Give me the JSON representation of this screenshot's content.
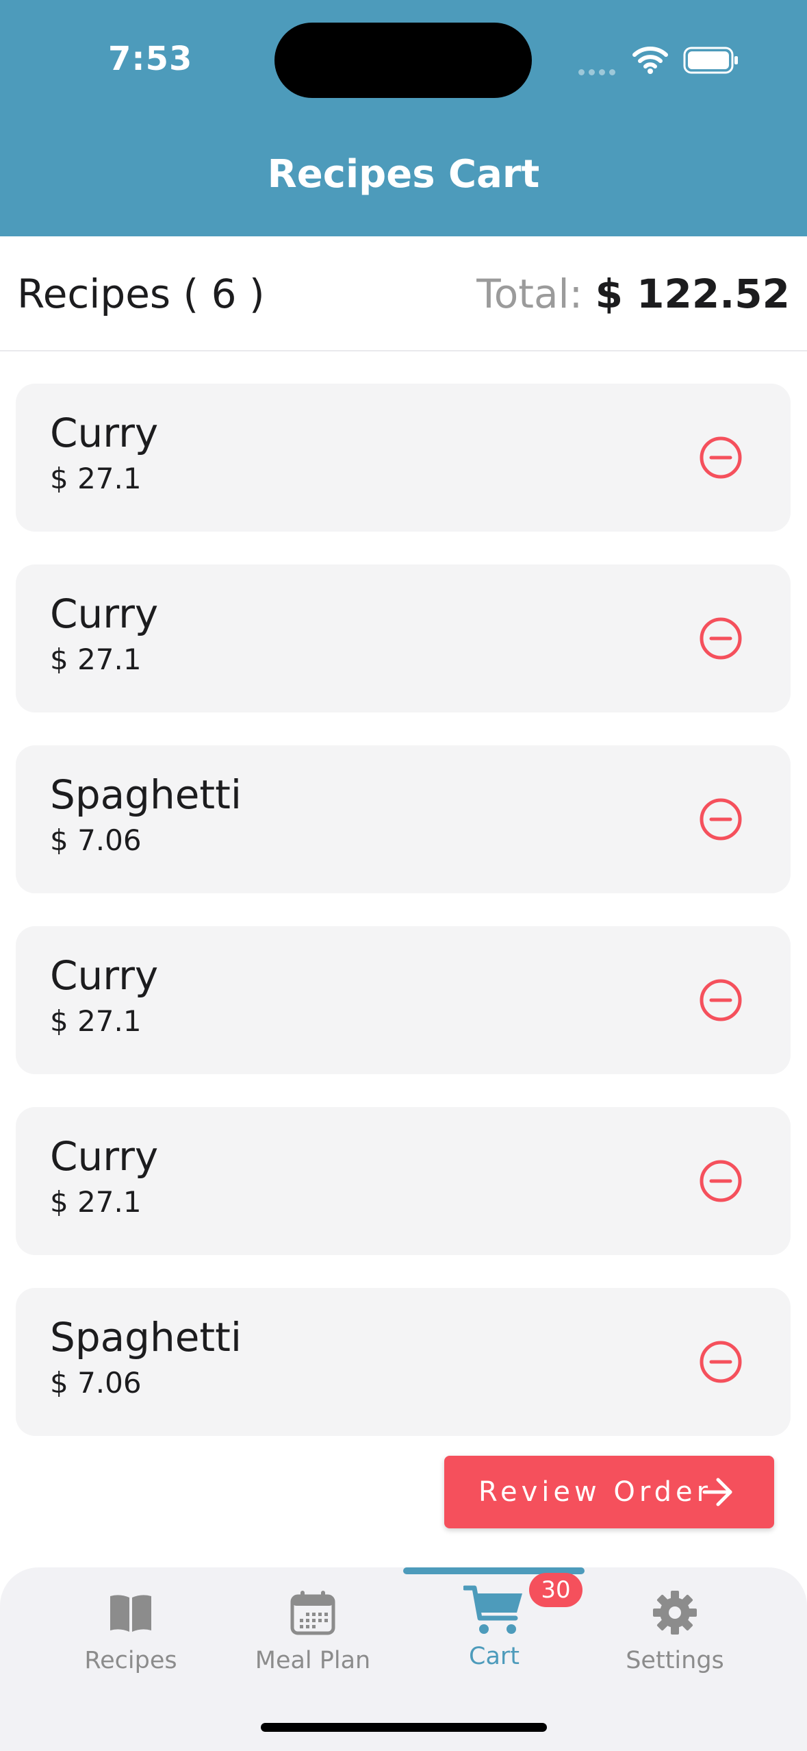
{
  "status_bar": {
    "time": "7:53"
  },
  "header": {
    "title": "Recipes Cart"
  },
  "summary": {
    "recipes_count": "Recipes ( 6 )",
    "total_label": "Total: ",
    "total_value": "$ 122.52"
  },
  "cart_items": [
    {
      "name": "Curry",
      "price": "$ 27.1"
    },
    {
      "name": "Curry",
      "price": "$ 27.1"
    },
    {
      "name": "Spaghetti",
      "price": "$ 7.06"
    },
    {
      "name": "Curry",
      "price": "$ 27.1"
    },
    {
      "name": "Curry",
      "price": "$ 27.1"
    },
    {
      "name": "Spaghetti",
      "price": "$ 7.06"
    }
  ],
  "review_button": {
    "label": "Review Order"
  },
  "tabs": [
    {
      "label": "Recipes",
      "icon": "book-icon"
    },
    {
      "label": "Meal Plan",
      "icon": "calendar-icon"
    },
    {
      "label": "Cart",
      "icon": "cart-icon",
      "active": true,
      "badge": "30"
    },
    {
      "label": "Settings",
      "icon": "gear-icon"
    }
  ],
  "colors": {
    "primary": "#4d9bbb",
    "accent": "#f5505c",
    "card": "#f4f4f5",
    "tab_inactive": "#8c8c8c"
  }
}
